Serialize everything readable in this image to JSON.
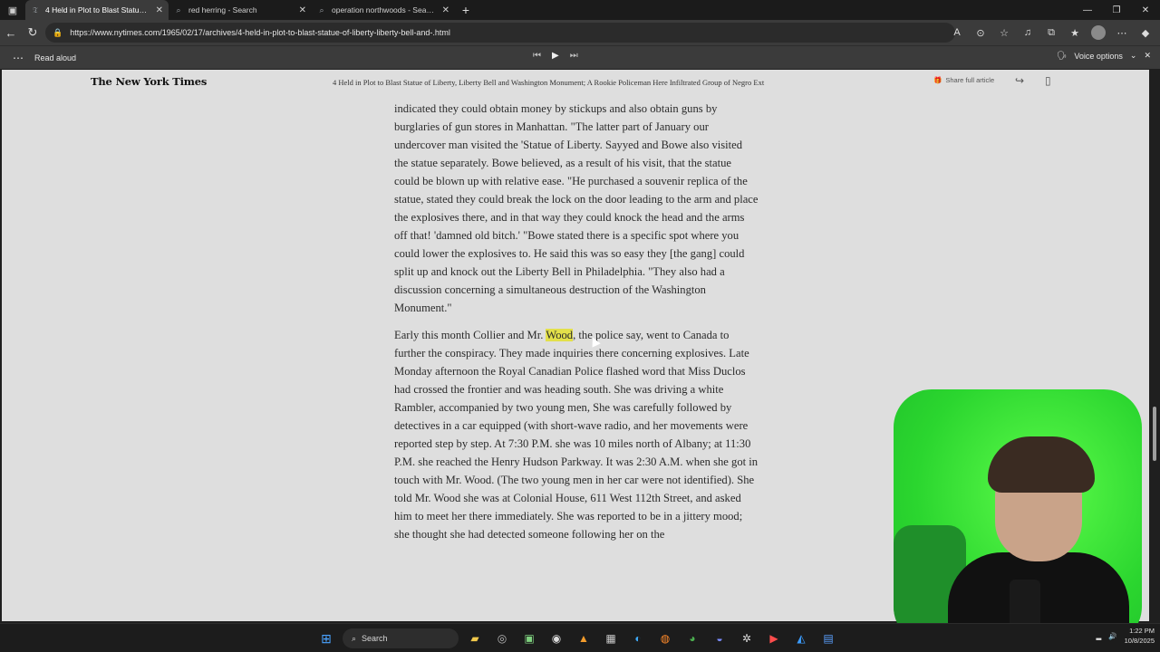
{
  "browser": {
    "tabs": [
      {
        "title": "4 Held in Plot to Blast Statue of Li",
        "icon": "nyt-icon",
        "active": true
      },
      {
        "title": "red herring - Search",
        "icon": "search-icon",
        "active": false
      },
      {
        "title": "operation northwoods - Search",
        "icon": "search-icon",
        "active": false
      }
    ],
    "new_tab": "+",
    "url": "https://www.nytimes.com/1965/02/17/archives/4-held-in-plot-to-blast-statue-of-liberty-liberty-bell-and-.html"
  },
  "read_aloud": {
    "label": "Read aloud",
    "voice_options": "Voice options"
  },
  "nyt": {
    "logo": "The New York Times",
    "headline": "4 Held in Plot to Blast Statue of Liberty, Liberty Bell and Washington Monument; A Rookie Policeman Here Infiltrated Group of Negro Ext",
    "share_full": "Share full article"
  },
  "article": {
    "p1": "indicated they could obtain money by stickups and also obtain guns by burglaries of gun stores in Manhattan. \"The latter part of January our undercover man visited the 'Statue of Liberty. Sayyed and Bowe also visited the statue separately. Bowe believed, as a result of his visit, that the statue could be blown up with relative ease. \"He purchased a souvenir replica of the statue, stated they could break the lock on the door leading to the arm and place the explosives there, and in that way they could knock the head and the arms off that! 'damned old bitch.' \"Bowe stated there is a specific spot where you could lower the explosives to. He said this was so easy they [the gang] could split up and knock out the Liberty Bell in Philadelphia. \"They also had a discussion concerning a simultaneous destruction of the Washington Monument.\"",
    "p2_before": "Early this month Collier and Mr. ",
    "p2_highlight": "Wood",
    "p2_after": ", the police say, went to Canada to further the conspiracy. They made inquiries there concerning explosives. Late Monday afternoon the Royal Canadian Police flashed word that Miss Duclos had crossed the frontier and was heading south. She was driving a white Rambler, accompanied by two young men, She was carefully followed by detectives in a car equipped (with short-wave radio, and her movements were reported step by step. At 7:30 P.M. she was 10 miles north of Albany; at 11:30 P.M. she reached the Henry Hudson Parkway. It was 2:30 A.M. when she got in touch with Mr. Wood. (The two young men in her car were not identified). She told Mr. Wood she was at Colonial House, 611 West 112th Street, and asked him to meet her there immediately. She was reported to be in a jittery mood; she thought she had detected someone following her on the"
  },
  "taskbar": {
    "search_label": "Search",
    "time": "1:22 PM",
    "date": "10/8/2025"
  }
}
